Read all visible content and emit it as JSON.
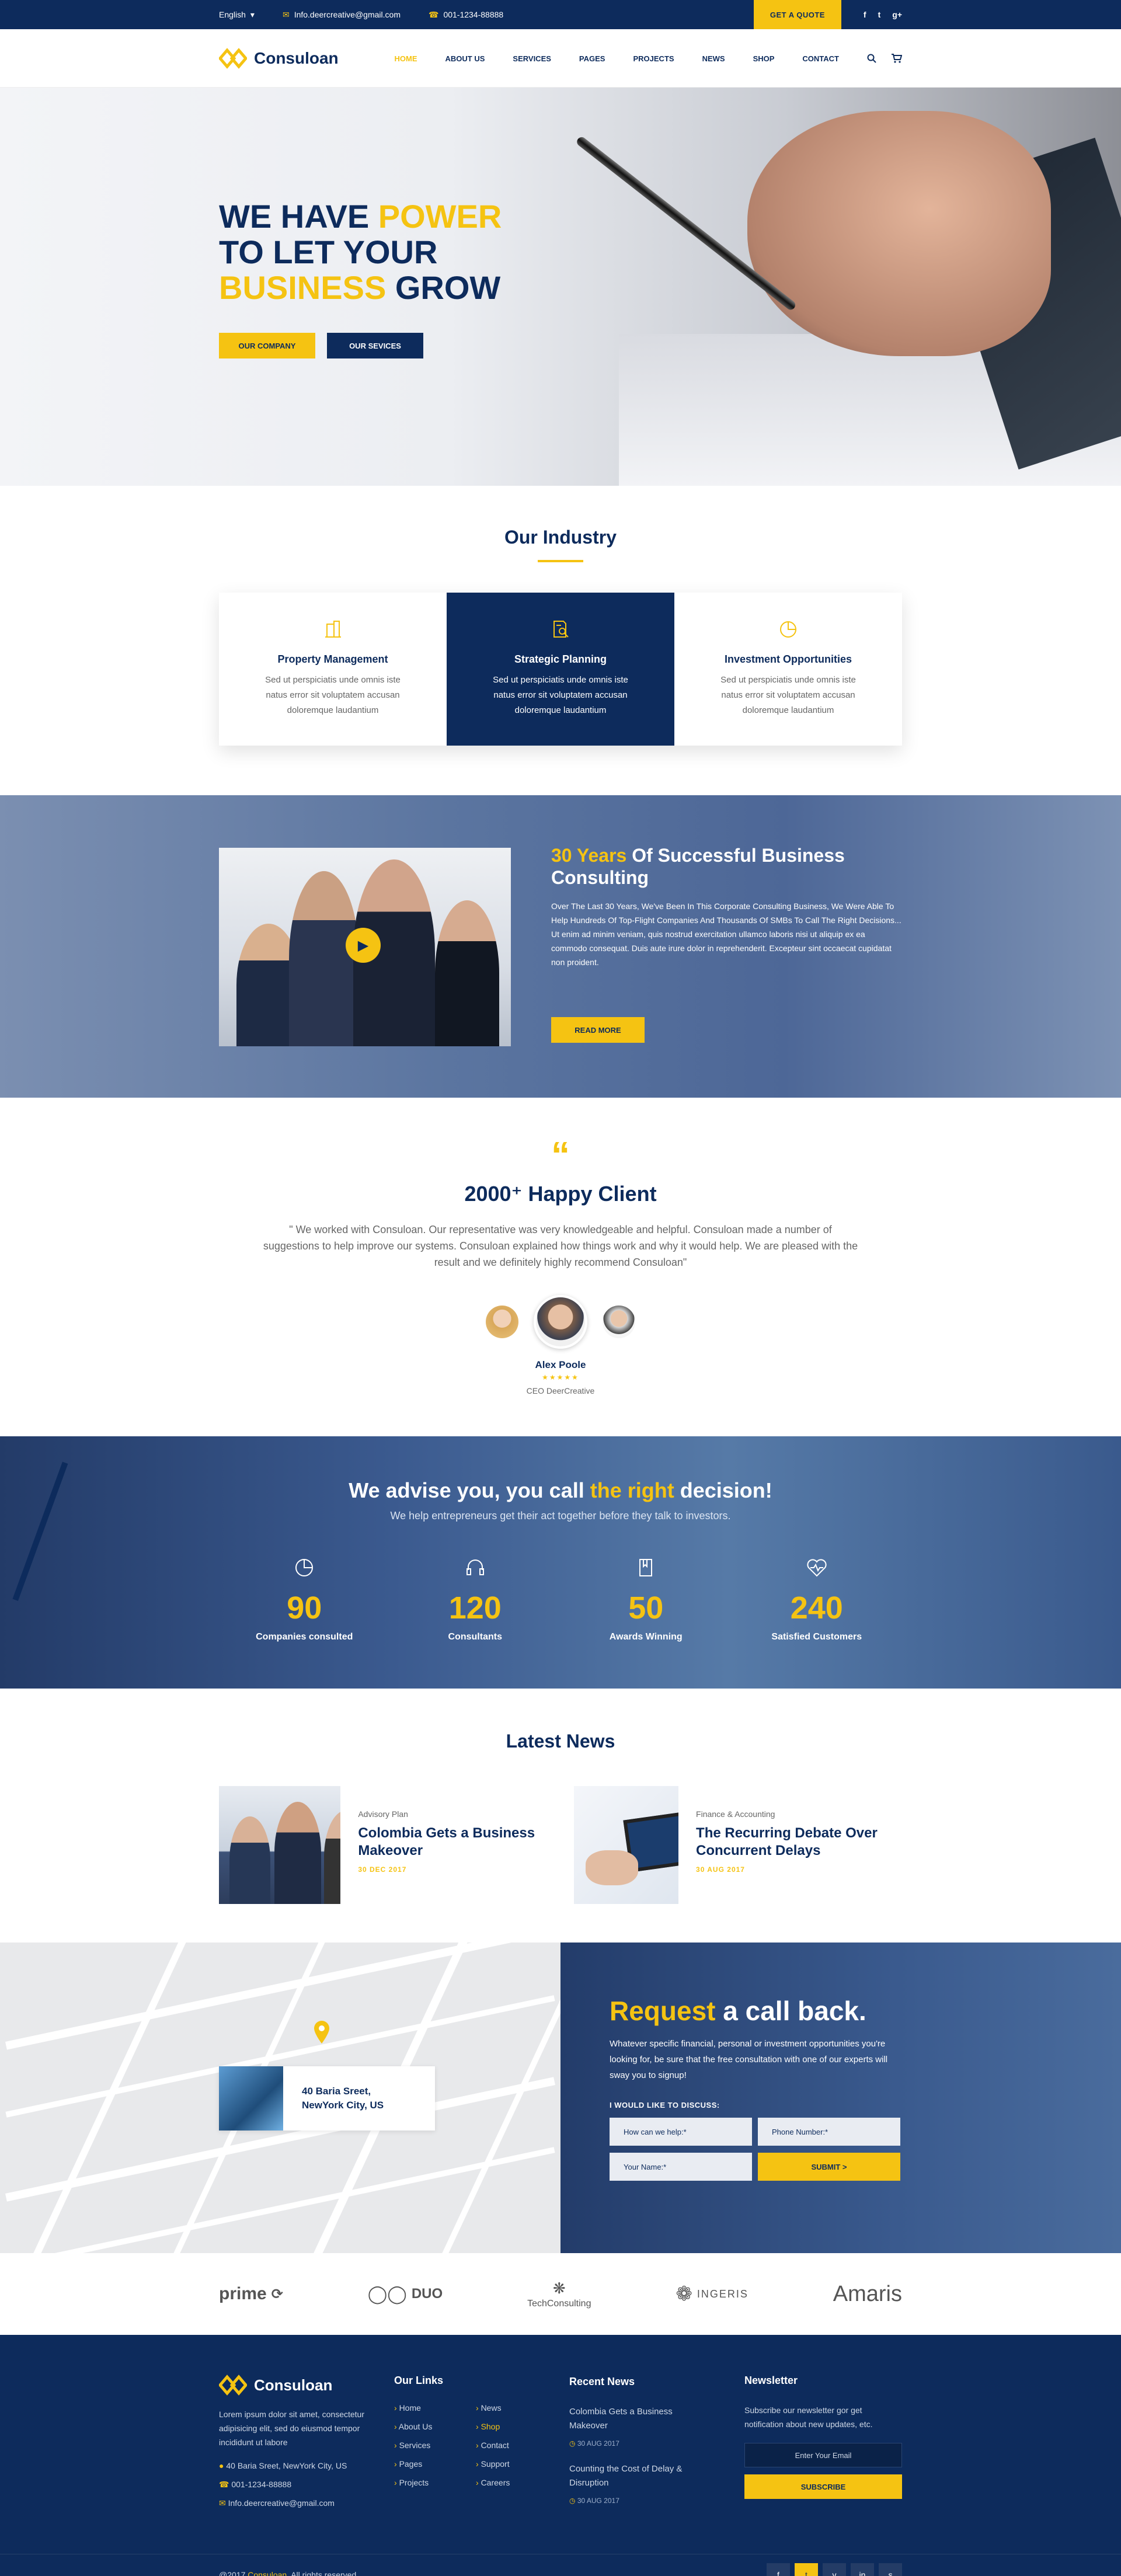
{
  "colors": {
    "navy": "#0d2b5c",
    "yellow": "#f5c312"
  },
  "topbar": {
    "language": "English",
    "email": "Info.deercreative@gmail.com",
    "phone": "001-1234-88888",
    "quote_btn": "GET A QUOTE",
    "social": [
      "f",
      "t",
      "g+"
    ]
  },
  "nav": {
    "logo": "Consuloan",
    "menu": [
      "HOME",
      "ABOUT US",
      "SERVICES",
      "PAGES",
      "PROJECTS",
      "NEWS",
      "SHOP",
      "CONTACT"
    ],
    "icons": [
      "search-icon",
      "cart-icon"
    ]
  },
  "hero": {
    "line1a": "WE HAVE ",
    "line1b": "POWER",
    "line2": "TO LET YOUR",
    "line3a": "BUSINESS",
    "line3b": " GROW",
    "btn1": "OUR COMPANY",
    "btn2": "OUR SEVICES"
  },
  "industry": {
    "title": "Our Industry",
    "cards": [
      {
        "title": "Property Management",
        "text": "Sed ut perspiciatis unde omnis iste natus error sit voluptatem accusan doloremque laudantium",
        "icon": "building-icon"
      },
      {
        "title": "Strategic Planning",
        "text": "Sed ut perspiciatis unde omnis iste natus error sit voluptatem accusan doloremque laudantium",
        "icon": "document-search-icon"
      },
      {
        "title": "Investment Opportunities",
        "text": "Sed ut perspiciatis unde omnis iste natus error sit voluptatem accusan doloremque laudantium",
        "icon": "pie-chart-icon"
      }
    ]
  },
  "about": {
    "title_y": "30 Years",
    "title_rest": " Of Successful Business Consulting",
    "p1": "Over The Last 30 Years, We've Been In This Corporate Consulting Business, We Were Able To Help Hundreds Of Top-Flight Companies And Thousands Of SMBs To Call The Right Decisions...",
    "p2": "Ut enim ad minim veniam, quis nostrud exercitation ullamco laboris nisi ut aliquip ex ea commodo consequat. Duis aute irure dolor in reprehenderit. Excepteur sint occaecat cupidatat non proident.",
    "btn": "READ MORE"
  },
  "testimonial": {
    "quote": "“",
    "title": "2000⁺ Happy Client",
    "text": "\" We worked with Consuloan. Our representative was  very knowledgeable and helpful. Consuloan made a number of suggestions to help improve our systems. Consuloan explained how things work and why it would help. We are pleased with the result and we definitely highly recommend Consuloan\"",
    "name": "Alex Poole",
    "stars": "★★★★★",
    "role": "CEO DeerCreative"
  },
  "advise": {
    "a": "We advise you, you call ",
    "y": "the right",
    "b": " decision!",
    "sub": "We help entrepreneurs get their act together before they talk to investors.",
    "stats": [
      {
        "num": "90",
        "label": "Companies consulted",
        "icon": "pie-chart-icon"
      },
      {
        "num": "120",
        "label": "Consultants",
        "icon": "headset-icon"
      },
      {
        "num": "50",
        "label": "Awards Winning",
        "icon": "book-icon"
      },
      {
        "num": "240",
        "label": "Satisfied Customers",
        "icon": "heart-pulse-icon"
      }
    ]
  },
  "news": {
    "title": "Latest News",
    "items": [
      {
        "cat": "Advisory Plan",
        "title": "Colombia Gets a Business Makeover",
        "date": "30 DEC 2017"
      },
      {
        "cat": "Finance & Accounting",
        "title": "The Recurring Debate Over Concurrent Delays",
        "date": "30 AUG 2017"
      }
    ]
  },
  "contact": {
    "address1": "40 Baria Sreet,",
    "address2": "NewYork City, US",
    "title_y": "Request",
    "title_rest": " a call back.",
    "text": "Whatever specific financial, personal or investment opportunities you're looking for, be sure that the free consultation with one of our experts will sway you to signup!",
    "label": "I WOULD LIKE TO DISCUSS:",
    "f1": "How can we help:*",
    "f2": "Phone Number:*",
    "f3": "Your Name:*",
    "submit": "SUBMIT  >"
  },
  "partners": [
    "prime",
    "DUO",
    "TechConsulting",
    "INGERIS",
    "Amaris"
  ],
  "footer": {
    "logo": "Consuloan",
    "about": "Lorem ipsum dolor sit amet, consectetur adipisicing elit, sed do eiusmod tempor incididunt ut labore",
    "address": "40 Baria Sreet, NewYork City, US",
    "phone": "001-1234-88888",
    "email": "Info.deercreative@gmail.com",
    "links_title": "Our Links",
    "links": [
      "Home",
      "News",
      "About Us",
      "Shop",
      "Services",
      "Contact",
      "Pages",
      "Support",
      "Projects",
      "Careers"
    ],
    "news_title": "Recent News",
    "news": [
      {
        "t": "Colombia Gets a Business Makeover",
        "d": "30 AUG 2017"
      },
      {
        "t": "Counting the Cost of Delay & Disruption",
        "d": "30 AUG 2017"
      }
    ],
    "nl_title": "Newsletter",
    "nl_text": "Subscribe our newsletter gor get notification about new updates, etc.",
    "nl_placeholder": "Enter Your Email",
    "nl_btn": "SUBSCRIBE",
    "copy_a": "@2017 ",
    "copy_y": "Consuloan",
    "copy_b": ". All rights reserved.",
    "social": [
      "f",
      "t",
      "v",
      "in",
      "s"
    ]
  }
}
